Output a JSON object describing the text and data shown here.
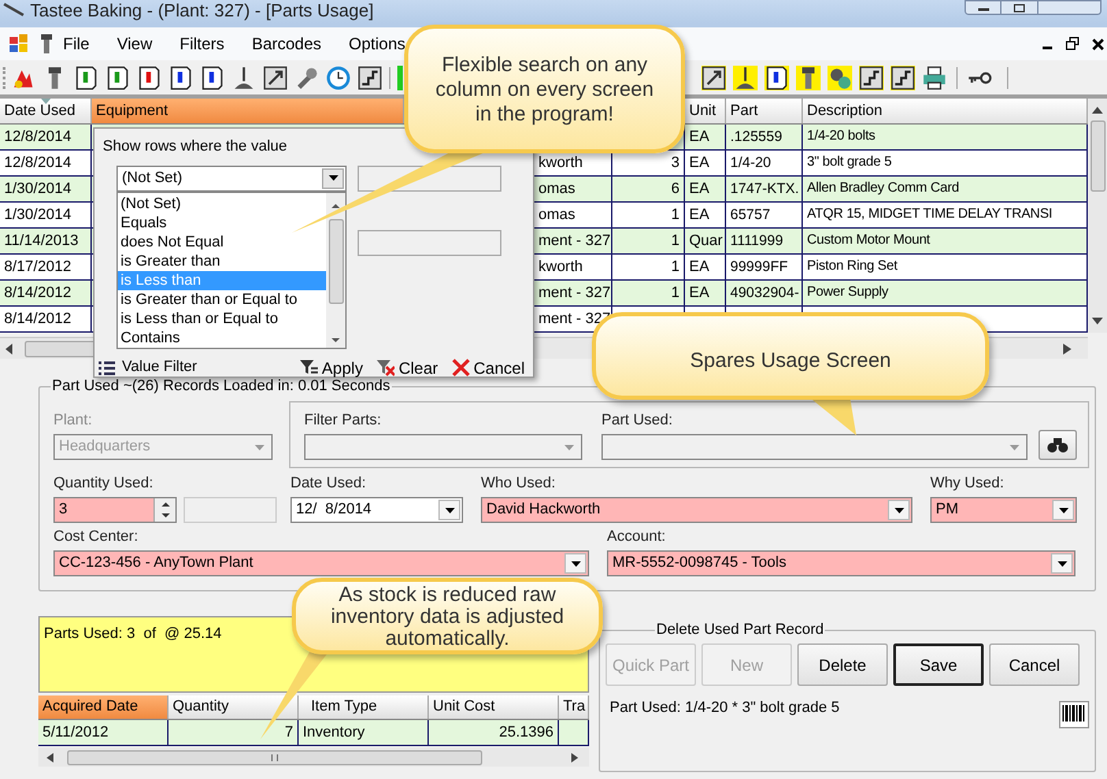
{
  "window": {
    "title": "Tastee Baking - (Plant: 327) - [Parts Usage]"
  },
  "menu": [
    {
      "label": "File"
    },
    {
      "label": "View"
    },
    {
      "label": "Filters"
    },
    {
      "label": "Barcodes"
    },
    {
      "label": "Options"
    }
  ],
  "grid": {
    "columns": [
      {
        "label": "Date Used",
        "active": false
      },
      {
        "label": "Equipment",
        "active": true
      },
      {},
      {},
      {
        "label": "Unit",
        "active": false
      },
      {
        "label": "Part",
        "active": false
      },
      {
        "label": "Description",
        "active": false
      }
    ],
    "rows": [
      {
        "cells": [
          "12/8/2014",
          null,
          null,
          null,
          "EA",
          ".125559",
          "1/4-20 bolts"
        ]
      },
      {
        "cells": [
          "12/8/2014",
          null,
          "kworth",
          "3",
          "EA",
          "1/4-20",
          "3\" bolt grade 5"
        ]
      },
      {
        "cells": [
          "1/30/2014",
          null,
          "omas",
          "6",
          "EA",
          "1747-KTX.",
          "Allen Bradley Comm Card"
        ]
      },
      {
        "cells": [
          "1/30/2014",
          null,
          "omas",
          "1",
          "EA",
          "65757",
          "ATQR 15, MIDGET TIME DELAY TRANSI"
        ]
      },
      {
        "cells": [
          "11/14/2013",
          null,
          "ment - 327",
          "1",
          "Quar",
          "1111999",
          "Custom Motor Mount"
        ]
      },
      {
        "cells": [
          "8/17/2012",
          null,
          "kworth",
          "1",
          "EA",
          "99999FF",
          "Piston Ring Set"
        ]
      },
      {
        "cells": [
          "8/14/2012",
          null,
          "ment - 327",
          "1",
          "EA",
          "49032904-",
          "Power Supply"
        ]
      },
      {
        "cells": [
          "8/14/2012",
          null,
          "ment - 327",
          null,
          null,
          null,
          null
        ]
      }
    ]
  },
  "filter": {
    "prompt": "Show rows where the value",
    "operator": "(Not Set)",
    "options": [
      {
        "label": "(Not Set)",
        "selected": false
      },
      {
        "label": "Equals",
        "selected": false
      },
      {
        "label": "does Not Equal",
        "selected": false
      },
      {
        "label": "is Greater than",
        "selected": false
      },
      {
        "label": "is Less than",
        "selected": true
      },
      {
        "label": "is Greater than or Equal to",
        "selected": false
      },
      {
        "label": "is Less than or Equal to",
        "selected": false
      },
      {
        "label": "Contains",
        "selected": false
      }
    ],
    "footer_label": "Value Filter",
    "buttons": [
      {
        "label": "Apply",
        "kind": "apply"
      },
      {
        "label": "Clear",
        "kind": "clear"
      },
      {
        "label": "Cancel",
        "kind": "cancel"
      }
    ]
  },
  "part_used": {
    "title": "Part Used ~(26) Records Loaded in: 0.01 Seconds",
    "fields": [
      {
        "label": "Plant:",
        "value": "Headquarters",
        "kind": "combo",
        "disabled": true,
        "required": false
      },
      {
        "label": "Filter Parts:",
        "kind": "combo",
        "disabled": true,
        "required": false
      },
      {
        "label": "Part Used:",
        "kind": "combo",
        "disabled": true,
        "required": false
      },
      {
        "label": "Quantity Used:",
        "value": "3",
        "kind": "spinner",
        "disabled": false,
        "required": true
      },
      {
        "label": "Date Used:",
        "value": "12/  8/2014",
        "kind": "date",
        "disabled": false,
        "required": false
      },
      {
        "label": "Who Used:",
        "value": "David Hackworth",
        "kind": "combo",
        "disabled": false,
        "required": true
      },
      {
        "label": "Why Used:",
        "value": "PM",
        "kind": "combo",
        "disabled": false,
        "required": true
      },
      {
        "label": "Cost Center:",
        "value": "CC-123-456 - AnyTown Plant",
        "kind": "combo",
        "disabled": false,
        "required": true
      },
      {
        "label": "Account:",
        "value": "MR-5552-0098745 - Tools",
        "kind": "combo",
        "disabled": false,
        "required": true
      }
    ]
  },
  "memo": {
    "text": "Parts Used: 3  of  @ 25.14"
  },
  "inventory": {
    "columns": [
      {
        "label": "Acquired Date",
        "active": true
      },
      {
        "label": "Quantity",
        "active": false
      },
      {
        "label": "Item Type",
        "active": false
      },
      {
        "label": "Unit Cost",
        "active": false
      },
      {
        "label": "Tra",
        "active": false
      }
    ],
    "rows": [
      {
        "cells": [
          "5/11/2012",
          "7",
          "Inventory",
          "25.1396",
          null
        ]
      }
    ]
  },
  "record": {
    "title": "Delete Used Part Record",
    "buttons": [
      {
        "label": "Quick Part",
        "disabled": true,
        "default": false
      },
      {
        "label": "New",
        "disabled": true,
        "default": false
      },
      {
        "label": "Delete",
        "disabled": false,
        "default": false
      },
      {
        "label": "Save",
        "disabled": false,
        "default": true
      },
      {
        "label": "Cancel",
        "disabled": false,
        "default": false
      }
    ],
    "summary": "Part Used: 1/4-20 * 3\" bolt grade 5"
  },
  "callouts": [
    {
      "text": "Flexible search on any column on every screen in the program!"
    },
    {
      "text": "Spares Usage Screen"
    },
    {
      "text": "As stock is reduced raw inventory data is adjusted automatically."
    }
  ]
}
